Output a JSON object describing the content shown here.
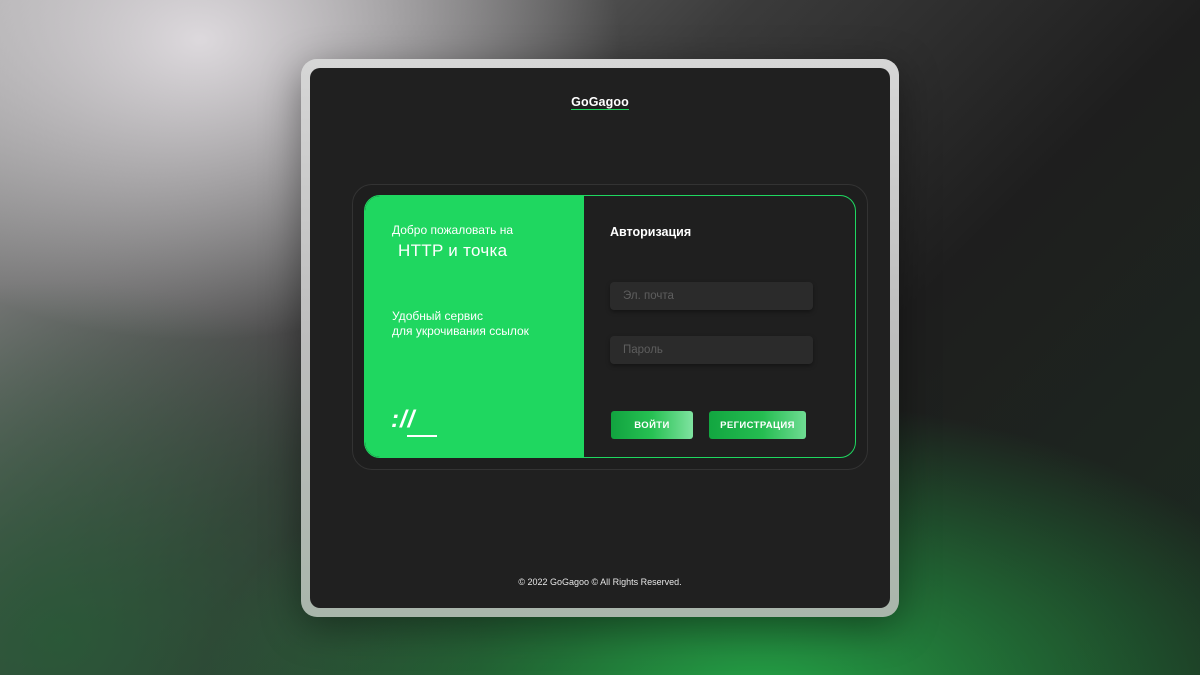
{
  "header": {
    "logo": "GoGagoo"
  },
  "promo": {
    "welcome": "Добро пожаловать на",
    "brand": "HTTP и точка",
    "tagline_line1": "Удобный сервис",
    "tagline_line2": "для укрочивания ссылок",
    "symbol": "://"
  },
  "auth": {
    "title": "Авторизация",
    "email_placeholder": "Эл. почта",
    "email_value": "",
    "password_placeholder": "Пароль",
    "password_value": "",
    "login_label": "ВОЙТИ",
    "register_label": "РЕГИСТРАЦИЯ"
  },
  "footer": {
    "copyright": "© 2022 GoGagoo © All Rights Reserved."
  },
  "colors": {
    "accent": "#1fd760",
    "screen_bg": "#202020",
    "field_bg": "#2b2b2b",
    "text": "#ffffff"
  }
}
